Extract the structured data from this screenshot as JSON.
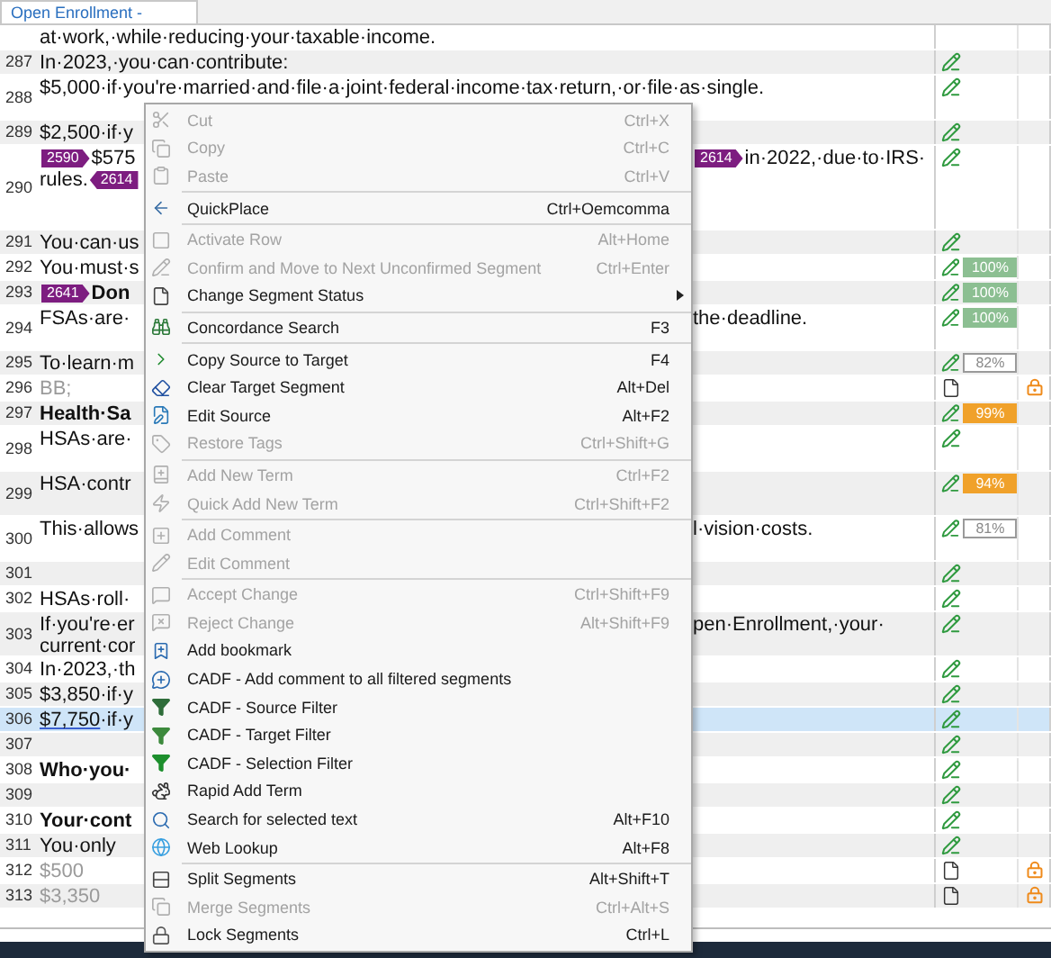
{
  "document_tab": "Open Enrollment -",
  "rows": [
    {
      "lines": [
        {
          "left": [
            "at·work,·while·reducing·your·taxable·income."
          ]
        }
      ],
      "bold": false,
      "locked": false,
      "selected": false
    },
    {
      "number": "287",
      "lines": [
        {
          "left": [
            "In·2023,·you·can·contribute:"
          ]
        }
      ],
      "kind": "edited",
      "bold": false,
      "locked": false,
      "selected": false
    },
    {
      "number": "288",
      "lines": [
        {
          "left": [
            "$5,000·if·you're·married·and·file·a·joint·federal·income·tax·return,·or·file·as·single."
          ]
        }
      ],
      "kind": "edited",
      "bold": false,
      "locked": false,
      "selected": false
    },
    {
      "number": "289",
      "lines": [
        {
          "left": [
            "$2,500·if·y"
          ]
        }
      ],
      "kind": "edited",
      "bold": false,
      "locked": false,
      "selected": false
    },
    {
      "number": "290",
      "lines": [
        {
          "left": [
            {
              "kind": "tag_open",
              "text": "2590"
            },
            "$575"
          ],
          "right": [
            {
              "kind": "tag_open",
              "text": "2614"
            },
            "in·2022,·due·to·IRS·"
          ]
        },
        {
          "left": [
            "rules.",
            {
              "kind": "tag_close",
              "text": "2614"
            }
          ]
        }
      ],
      "kind": "edited",
      "bold": false,
      "locked": false,
      "selected": false
    },
    {
      "number": "291",
      "lines": [
        {
          "left": [
            "You·can·us"
          ]
        }
      ],
      "kind": "edited",
      "bold": false,
      "locked": false,
      "selected": false
    },
    {
      "number": "292",
      "lines": [
        {
          "left": [
            "You·must·s"
          ]
        }
      ],
      "kind": "edited",
      "match": {
        "kind": "exact",
        "text": "100%"
      },
      "bold": false,
      "locked": false,
      "selected": false
    },
    {
      "number": "293",
      "lines": [
        {
          "left": [
            {
              "kind": "tag_open",
              "text": "2641"
            },
            "Don"
          ]
        }
      ],
      "kind": "edited",
      "match": {
        "kind": "exact",
        "text": "100%"
      },
      "bold": true,
      "locked": false,
      "selected": false
    },
    {
      "number": "294",
      "lines": [
        {
          "left": [
            "FSAs·are·"
          ],
          "right": [
            "the·deadline."
          ]
        }
      ],
      "kind": "edited",
      "match": {
        "kind": "exact",
        "text": "100%"
      },
      "bold": false,
      "locked": false,
      "selected": false
    },
    {
      "number": "295",
      "lines": [
        {
          "left": [
            "To·learn·m"
          ]
        }
      ],
      "kind": "edited",
      "match": {
        "kind": "fuzzy_low",
        "text": "82%"
      },
      "bold": false,
      "locked": false,
      "selected": false
    },
    {
      "number": "296",
      "lines": [
        {
          "left": [
            "BB;"
          ]
        }
      ],
      "kind": "source",
      "bold": false,
      "locked": true,
      "selected": false
    },
    {
      "number": "297",
      "lines": [
        {
          "left": [
            "Health·Sa"
          ]
        }
      ],
      "kind": "edited",
      "match": {
        "kind": "fuzzy_high",
        "text": "99%"
      },
      "bold": true,
      "locked": false,
      "selected": false
    },
    {
      "number": "298",
      "lines": [
        {
          "left": [
            "HSAs·are·"
          ]
        }
      ],
      "kind": "edited",
      "bold": false,
      "locked": false,
      "selected": false
    },
    {
      "number": "299",
      "lines": [
        {
          "left": [
            "HSA·contr"
          ]
        }
      ],
      "kind": "edited",
      "match": {
        "kind": "fuzzy_high",
        "text": "94%"
      },
      "bold": false,
      "locked": false,
      "selected": false
    },
    {
      "number": "300",
      "lines": [
        {
          "left": [
            "This·allows"
          ],
          "right": [
            "l·vision·costs."
          ]
        }
      ],
      "kind": "edited",
      "match": {
        "kind": "fuzzy_low",
        "text": "81%"
      },
      "bold": false,
      "locked": false,
      "selected": false
    },
    {
      "number": "301",
      "kind": "edited",
      "locked": false,
      "selected": false
    },
    {
      "number": "302",
      "lines": [
        {
          "left": [
            "HSAs·roll·"
          ]
        }
      ],
      "kind": "edited",
      "bold": false,
      "locked": false,
      "selected": false
    },
    {
      "number": "303",
      "lines": [
        {
          "left": [
            "If·you're·er"
          ],
          "right": [
            "pen·Enrollment,·your·"
          ]
        },
        {
          "left": [
            "current·cor"
          ]
        }
      ],
      "kind": "edited",
      "bold": false,
      "locked": false,
      "selected": false
    },
    {
      "number": "304",
      "lines": [
        {
          "left": [
            "In·2023,·th"
          ]
        }
      ],
      "kind": "edited",
      "bold": false,
      "locked": false,
      "selected": false
    },
    {
      "number": "305",
      "lines": [
        {
          "left": [
            "$3,850·if·y"
          ]
        }
      ],
      "kind": "edited",
      "bold": false,
      "locked": false,
      "selected": false
    },
    {
      "number": "306",
      "lines": [
        {
          "left": [
            {
              "kind": "link",
              "text": "$7,750"
            },
            "·if·y"
          ]
        }
      ],
      "kind": "edited",
      "bold": false,
      "locked": false,
      "selected": true
    },
    {
      "number": "307",
      "kind": "edited",
      "locked": false,
      "selected": false
    },
    {
      "number": "308",
      "lines": [
        {
          "left": [
            "Who·you·"
          ]
        }
      ],
      "kind": "edited",
      "bold": true,
      "locked": false,
      "selected": false
    },
    {
      "number": "309",
      "kind": "edited",
      "locked": false,
      "selected": false
    },
    {
      "number": "310",
      "lines": [
        {
          "left": [
            "Your·cont"
          ]
        }
      ],
      "kind": "edited",
      "bold": true,
      "locked": false,
      "selected": false
    },
    {
      "number": "311",
      "lines": [
        {
          "left": [
            "You·only"
          ]
        }
      ],
      "kind": "edited",
      "bold": false,
      "locked": false,
      "selected": false
    },
    {
      "number": "312",
      "lines": [
        {
          "left": [
            "$500"
          ]
        }
      ],
      "kind": "source",
      "bold": false,
      "locked": true,
      "selected": false
    },
    {
      "number": "313",
      "lines": [
        {
          "left": [
            "$3,350"
          ]
        }
      ],
      "kind": "source",
      "bold": false,
      "locked": true,
      "selected": false
    }
  ],
  "menu": {
    "groups": [
      [
        {
          "label": "Cut",
          "shortcut": "Ctrl+X",
          "disabled": true,
          "submenu": false
        },
        {
          "label": "Copy",
          "shortcut": "Ctrl+C",
          "disabled": true,
          "submenu": false
        },
        {
          "label": "Paste",
          "shortcut": "Ctrl+V",
          "disabled": true,
          "submenu": false
        }
      ],
      [
        {
          "label": "QuickPlace",
          "shortcut": "Ctrl+Oemcomma",
          "disabled": false,
          "submenu": false
        }
      ],
      [
        {
          "label": "Activate Row",
          "shortcut": "Alt+Home",
          "disabled": true,
          "submenu": false
        },
        {
          "label": "Confirm and Move to Next Unconfirmed Segment",
          "shortcut": "Ctrl+Enter",
          "disabled": true,
          "submenu": false
        },
        {
          "label": "Change Segment Status",
          "disabled": false,
          "submenu": true
        }
      ],
      [
        {
          "label": "Concordance Search",
          "shortcut": "F3",
          "disabled": false,
          "submenu": false
        }
      ],
      [
        {
          "label": "Copy Source to Target",
          "shortcut": "F4",
          "disabled": false,
          "submenu": false
        },
        {
          "label": "Clear Target Segment",
          "shortcut": "Alt+Del",
          "disabled": false,
          "submenu": false
        },
        {
          "label": "Edit Source",
          "shortcut": "Alt+F2",
          "disabled": false,
          "submenu": false
        },
        {
          "label": "Restore Tags",
          "shortcut": "Ctrl+Shift+G",
          "disabled": true,
          "submenu": false
        }
      ],
      [
        {
          "label": "Add New Term",
          "shortcut": "Ctrl+F2",
          "disabled": true,
          "submenu": false
        },
        {
          "label": "Quick Add New Term",
          "shortcut": "Ctrl+Shift+F2",
          "disabled": true,
          "submenu": false
        }
      ],
      [
        {
          "label": "Add Comment",
          "disabled": true,
          "submenu": false
        },
        {
          "label": "Edit Comment",
          "disabled": true,
          "submenu": false
        }
      ],
      [
        {
          "label": "Accept Change",
          "shortcut": "Ctrl+Shift+F9",
          "disabled": true,
          "submenu": false
        },
        {
          "label": "Reject Change",
          "shortcut": "Alt+Shift+F9",
          "disabled": true,
          "submenu": false
        },
        {
          "label": "Add bookmark",
          "disabled": false,
          "submenu": false
        },
        {
          "label": "CADF - Add comment to all filtered segments",
          "disabled": false,
          "submenu": false
        },
        {
          "label": "CADF - Source Filter",
          "disabled": false,
          "submenu": false
        },
        {
          "label": "CADF - Target Filter",
          "disabled": false,
          "submenu": false
        },
        {
          "label": "CADF - Selection Filter",
          "disabled": false,
          "submenu": false
        },
        {
          "label": "Rapid Add Term",
          "disabled": false,
          "submenu": false
        },
        {
          "label": "Search for selected text",
          "shortcut": "Alt+F10",
          "disabled": false,
          "submenu": false
        },
        {
          "label": "Web Lookup",
          "shortcut": "Alt+F8",
          "disabled": false,
          "submenu": false
        }
      ],
      [
        {
          "label": "Split Segments",
          "shortcut": "Alt+Shift+T",
          "disabled": false,
          "submenu": false
        },
        {
          "label": "Merge Segments",
          "shortcut": "Ctrl+Alt+S",
          "disabled": true,
          "submenu": false
        },
        {
          "label": "Lock Segments",
          "shortcut": "Ctrl+L",
          "disabled": false,
          "submenu": false
        }
      ]
    ]
  }
}
